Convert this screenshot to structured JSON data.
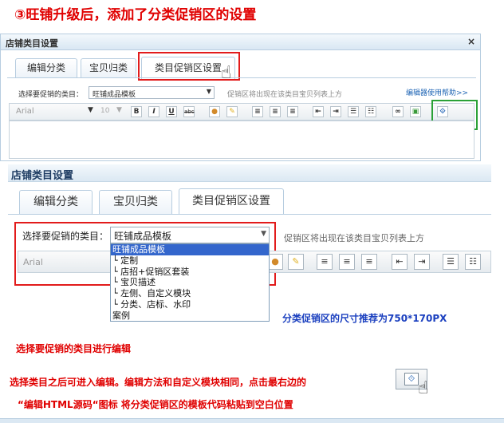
{
  "step_title": "③旺铺升级后，添加了分类促销区的设置",
  "panel_small": {
    "title": "店铺类目设置",
    "close_glyph": "×",
    "tabs": [
      "编辑分类",
      "宝贝归类",
      "类目促销区设置"
    ],
    "select_label": "选择要促销的类目：",
    "select_value": "旺铺成品模板",
    "note": "促销区将出现在该类目宝贝列表上方",
    "help_link": "编辑器使用帮助>>",
    "font_name": "Arial",
    "font_size": "10",
    "buttons": [
      "B",
      "I",
      "U",
      "abc"
    ]
  },
  "panel_large": {
    "title": "店铺类目设置",
    "tabs": [
      "编辑分类",
      "宝贝归类",
      "类目促销区设置"
    ],
    "select_label": "选择要促销的类目：",
    "select_value": "旺铺成品模板",
    "note": "促销区将出现在该类目宝贝列表上方",
    "font_name": "Arial",
    "dropdown_items": [
      "旺铺成品模板",
      "└ 定制",
      "└ 店招+促销区套装",
      "└ 宝贝描述",
      "└ 左侧、自定义模块",
      "└ 分类、店标、水印",
      "案例"
    ]
  },
  "size_note": "分类促销区的尺寸推荐为750*170PX",
  "instructions": {
    "line1": "选择要促销的类目进行编辑",
    "line2": "选择类目之后可进入编辑。编辑方法和自定义模块相同，点击最右边的",
    "line3": "“编辑HTML源码“图标  将分类促销区的模板代码粘贴到空白位置"
  },
  "icons": {
    "cursor": "hand-pointer-icon",
    "html_source": "html-source-icon"
  },
  "colors": {
    "title_red": "#e00000",
    "highlight_red": "#e21b1b",
    "highlight_green": "#2aa136",
    "size_note_blue": "#1a3fbf",
    "selection_blue": "#3366cc"
  }
}
